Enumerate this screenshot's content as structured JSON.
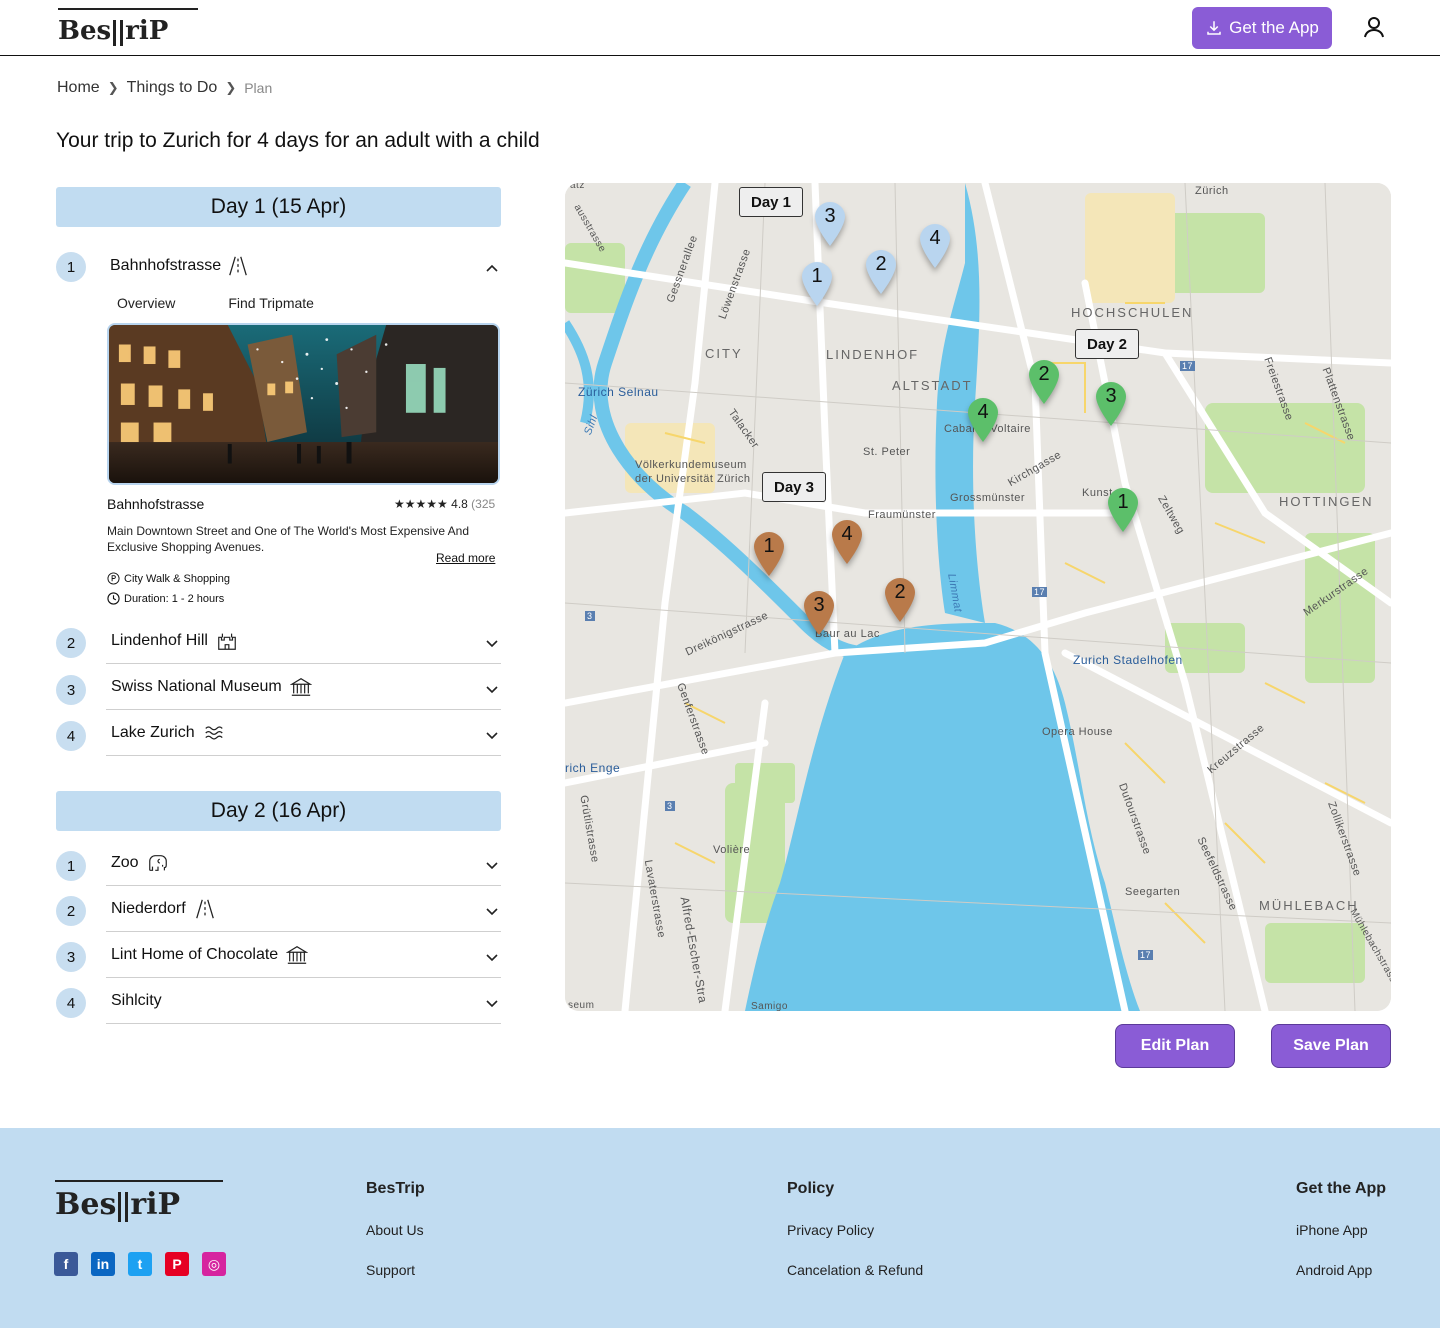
{
  "header": {
    "logo_left": "Bes",
    "logo_right": "riP",
    "get_app_label": "Get the App"
  },
  "breadcrumb": [
    "Home",
    "Things to Do",
    "Plan"
  ],
  "page_title": "Your trip to Zurich for 4 days for an adult with a child",
  "days": [
    {
      "label": "Day 1 (15 Apr)",
      "items": [
        {
          "num": "1",
          "name": "Bahnhofstrasse",
          "icon": "road-icon",
          "expanded": true
        },
        {
          "num": "2",
          "name": "Lindenhof Hill",
          "icon": "castle-icon"
        },
        {
          "num": "3",
          "name": "Swiss National Museum",
          "icon": "museum-icon"
        },
        {
          "num": "4",
          "name": "Lake Zurich",
          "icon": "waves-icon"
        }
      ]
    },
    {
      "label": "Day 2 (16 Apr)",
      "items": [
        {
          "num": "1",
          "name": "Zoo",
          "icon": "elephant-icon"
        },
        {
          "num": "2",
          "name": "Niederdorf",
          "icon": "road-icon"
        },
        {
          "num": "3",
          "name": "Lint Home of Chocolate",
          "icon": "museum-icon"
        },
        {
          "num": "4",
          "name": "Sihlcity",
          "icon": ""
        }
      ]
    }
  ],
  "detail": {
    "tabs": [
      "Overview",
      "Find Tripmate"
    ],
    "name": "Bahnhofstrasse",
    "stars": "★★★★★",
    "rating": "4.8",
    "rating_count": "(325",
    "description": "Main Downtown Street and One of The World's Most Expensive And Exclusive Shopping Avenues.",
    "read_more": "Read more",
    "category": "City Walk & Shopping",
    "duration": "Duration: 1 - 2 hours"
  },
  "map": {
    "day_tags": [
      "Day 1",
      "Day 2",
      "Day 3"
    ],
    "day_colors": {
      "day1": "#b9d5ef",
      "day2": "#5cbf6a",
      "day3": "#b97a4a"
    },
    "labels": {
      "zurich": "Zürich",
      "hochschulen": "HOCHSCHULEN",
      "city": "CITY",
      "lindenhof": "LINDENHOF",
      "altstadt": "ALTSTADT",
      "selnau": "Zürich Selnau",
      "sihl": "Sihl",
      "gessnerallee": "Gessnerallee",
      "lowenstrasse": "Löwenstrasse",
      "talacker": "Talacker",
      "voelker": "Völkerkundemuseum",
      "voelker2": "der Universität Zürich",
      "stpeter": "St. Peter",
      "cabaret": "Cabaret Voltaire",
      "kirchgasse": "Kirchgasse",
      "grossmuenster": "Grossmünster",
      "fraumuenster": "Fraumünster",
      "kunst": "Kunst",
      "zeltweg": "Zeltweg",
      "hottingen": "HOTTINGEN",
      "freiestrasse": "Freiestrasse",
      "plattenstrasse": "Plattenstrasse",
      "limmat": "Limmat",
      "baur": "Baur au Lac",
      "dreikoenig": "Dreikönigstrasse",
      "stadelhofen": "Zurich Stadelhofen",
      "merkur": "Merkurstrasse",
      "genfer": "Genferstrasse",
      "opera": "Opera House",
      "enge": "rich Enge",
      "kreuz": "Kreuzstrasse",
      "dufour": "Dufourstrasse",
      "seefeld": "Seefeldstrasse",
      "zollikerstrasse": "Zollikerstrasse",
      "voliere": "Volière",
      "seegarten": "Seegarten",
      "muehlebach": "MÜHLEBACH",
      "lavater": "Lavaterstrasse",
      "alfred": "Alfred-Escher-Stra",
      "gruetli": "Grütlistrasse",
      "muehlebachstr": "Mühlebachstrasse",
      "samigo": "Samigo",
      "seum": "seum",
      "ausstrasse": "ausstrasse",
      "atz": "atz",
      "r17a": "17",
      "r17b": "17",
      "r17c": "17",
      "r3a": "3",
      "r3b": "3"
    },
    "pins": [
      {
        "day": "day1",
        "n": "3"
      },
      {
        "day": "day1",
        "n": "4"
      },
      {
        "day": "day1",
        "n": "2"
      },
      {
        "day": "day1",
        "n": "1"
      },
      {
        "day": "day2",
        "n": "2"
      },
      {
        "day": "day2",
        "n": "3"
      },
      {
        "day": "day2",
        "n": "4"
      },
      {
        "day": "day2",
        "n": "1"
      },
      {
        "day": "day3",
        "n": "1"
      },
      {
        "day": "day3",
        "n": "4"
      },
      {
        "day": "day3",
        "n": "3"
      },
      {
        "day": "day3",
        "n": "2"
      }
    ]
  },
  "actions": {
    "edit": "Edit Plan",
    "save": "Save Plan"
  },
  "footer": {
    "col1_title": "BesTrip",
    "col1_links": [
      "About Us",
      "Support"
    ],
    "col2_title": "Policy",
    "col2_links": [
      "Privacy Policy",
      "Cancelation & Refund"
    ],
    "col3_title": "Get the App",
    "col3_links": [
      "iPhone App",
      "Android App"
    ],
    "socials": [
      {
        "name": "facebook-icon",
        "glyph": "f",
        "color": "#3b5998"
      },
      {
        "name": "linkedin-icon",
        "glyph": "in",
        "color": "#0a66c2"
      },
      {
        "name": "twitter-icon",
        "glyph": "t",
        "color": "#1da1f2"
      },
      {
        "name": "pinterest-icon",
        "glyph": "P",
        "color": "#e60023"
      },
      {
        "name": "instagram-icon",
        "glyph": "◎",
        "color": "#d6249f"
      }
    ]
  }
}
